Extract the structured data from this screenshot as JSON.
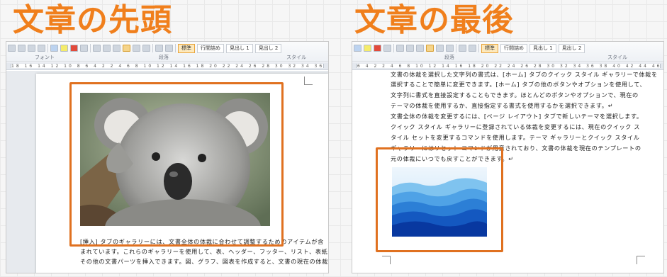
{
  "colors": {
    "heading": "#f07f1c",
    "highlight": "#e07120",
    "page_bg": "#ffffff"
  },
  "left": {
    "heading": "文章の先頭",
    "ribbon": {
      "font_group": "フォント",
      "paragraph_group": "段落",
      "style_group": "スタイル",
      "styles": [
        "標準",
        "行間詰め",
        "見出し 1",
        "見出し 2"
      ]
    },
    "ruler": "18 16 14 12 10 8 6 4 2   2 4 6 8 10 12 14 16 18 20 22 24 26 28 30 32 34 36 38 40 42 44 46 48",
    "image_label": "koala photo",
    "body_lines": [
      "[挿入] タブのギャラリーには、文書全体の体裁に合わせて調整するためのアイテムが含",
      "まれています。これらのギャラリーを使用して、表、ヘッダー、フッター、リスト、表紙や、",
      "その他の文書パーツを挿入できます。図、グラフ、図表を作成すると、文書の現在の体裁"
    ]
  },
  "right": {
    "heading": "文章の最後",
    "ribbon": {
      "paragraph_group": "段落",
      "style_group": "スタイル",
      "styles": [
        "標準",
        "行間詰め",
        "見出し 1",
        "見出し 2"
      ]
    },
    "ruler": "6 4 2   2 4 6 8 10 12 14 16 18 20 22 24 26 28 30 32 34 36 38 40 42 44 46 48 50 52",
    "image_label": "blue mountains image",
    "body_lines": [
      "文書の体裁を選択した文字列の書式は、[ホーム] タブのクイック スタイル ギャラリーで体裁を",
      "選択することで簡単に変更できます。[ホーム] タブの他のボタンやオプションを使用して、",
      "文字列に書式を直接設定することもできます。ほとんどのボタンやオプションで、現在の",
      "テーマの体裁を使用するか、直接指定する書式を使用するかを選択できます。↵",
      "文書全体の体裁を変更するには、[ページ レイアウト] タブで新しいテーマを選択します。",
      "クイック スタイル ギャラリーに登録されている体裁を変更するには、現在のクイック ス",
      "タイル セットを変更するコマンドを使用します。テーマ ギャラリーとクイック スタイル",
      "ギャラリーにはリセット コマンドが用意されており、文書の体裁を現在のテンプレートの",
      "元の体裁にいつでも戻すことができます。↵"
    ]
  }
}
